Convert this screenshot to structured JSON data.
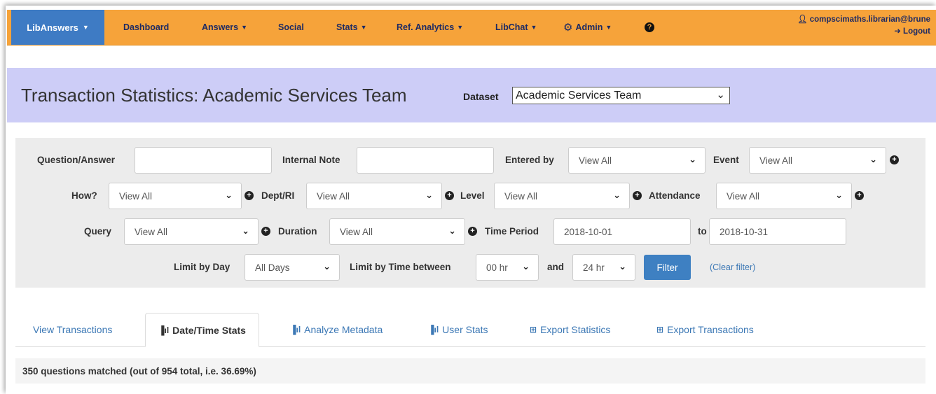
{
  "nav": {
    "brand": "LibAnswers",
    "items": [
      {
        "label": "Dashboard",
        "caret": false
      },
      {
        "label": "Answers",
        "caret": true
      },
      {
        "label": "Social",
        "caret": false
      },
      {
        "label": "Stats",
        "caret": true
      },
      {
        "label": "Ref. Analytics",
        "caret": true
      },
      {
        "label": "LibChat",
        "caret": true
      },
      {
        "label": "Admin",
        "caret": true
      }
    ],
    "user": "compscimaths.librarian@brune",
    "logout": "Logout"
  },
  "header": {
    "title": "Transaction Statistics: Academic Services Team",
    "dataset_label": "Dataset",
    "dataset_value": "Academic Services Team"
  },
  "filters": {
    "question_answer_label": "Question/Answer",
    "question_answer_value": "",
    "internal_note_label": "Internal Note",
    "internal_note_value": "",
    "entered_by_label": "Entered by",
    "entered_by_value": "View All",
    "event_label": "Event",
    "event_value": "View All",
    "how_label": "How?",
    "how_value": "View All",
    "dept_label": "Dept/RI",
    "dept_value": "View All",
    "level_label": "Level",
    "level_value": "View All",
    "attendance_label": "Attendance",
    "attendance_value": "View All",
    "query_label": "Query",
    "query_value": "View All",
    "duration_label": "Duration",
    "duration_value": "View All",
    "time_period_label": "Time Period",
    "time_from": "2018-10-01",
    "to_label": "to",
    "time_to": "2018-10-31",
    "limit_day_label": "Limit by Day",
    "limit_day_value": "All Days",
    "limit_time_label": "Limit by Time between",
    "time_start": "00 hr",
    "and_label": "and",
    "time_end": "24 hr",
    "filter_button": "Filter",
    "clear_filter": "(Clear filter)"
  },
  "tabs": [
    {
      "label": "View Transactions",
      "icon": ""
    },
    {
      "label": "Date/Time Stats",
      "icon": "bar-chart-icon"
    },
    {
      "label": "Analyze Metadata",
      "icon": "bar-chart-icon"
    },
    {
      "label": "User Stats",
      "icon": "bar-chart-icon"
    },
    {
      "label": "Export Statistics",
      "icon": "table-icon"
    },
    {
      "label": "Export Transactions",
      "icon": "table-icon"
    }
  ],
  "result": "350 questions matched (out of 954 total, i.e. 36.69%)"
}
